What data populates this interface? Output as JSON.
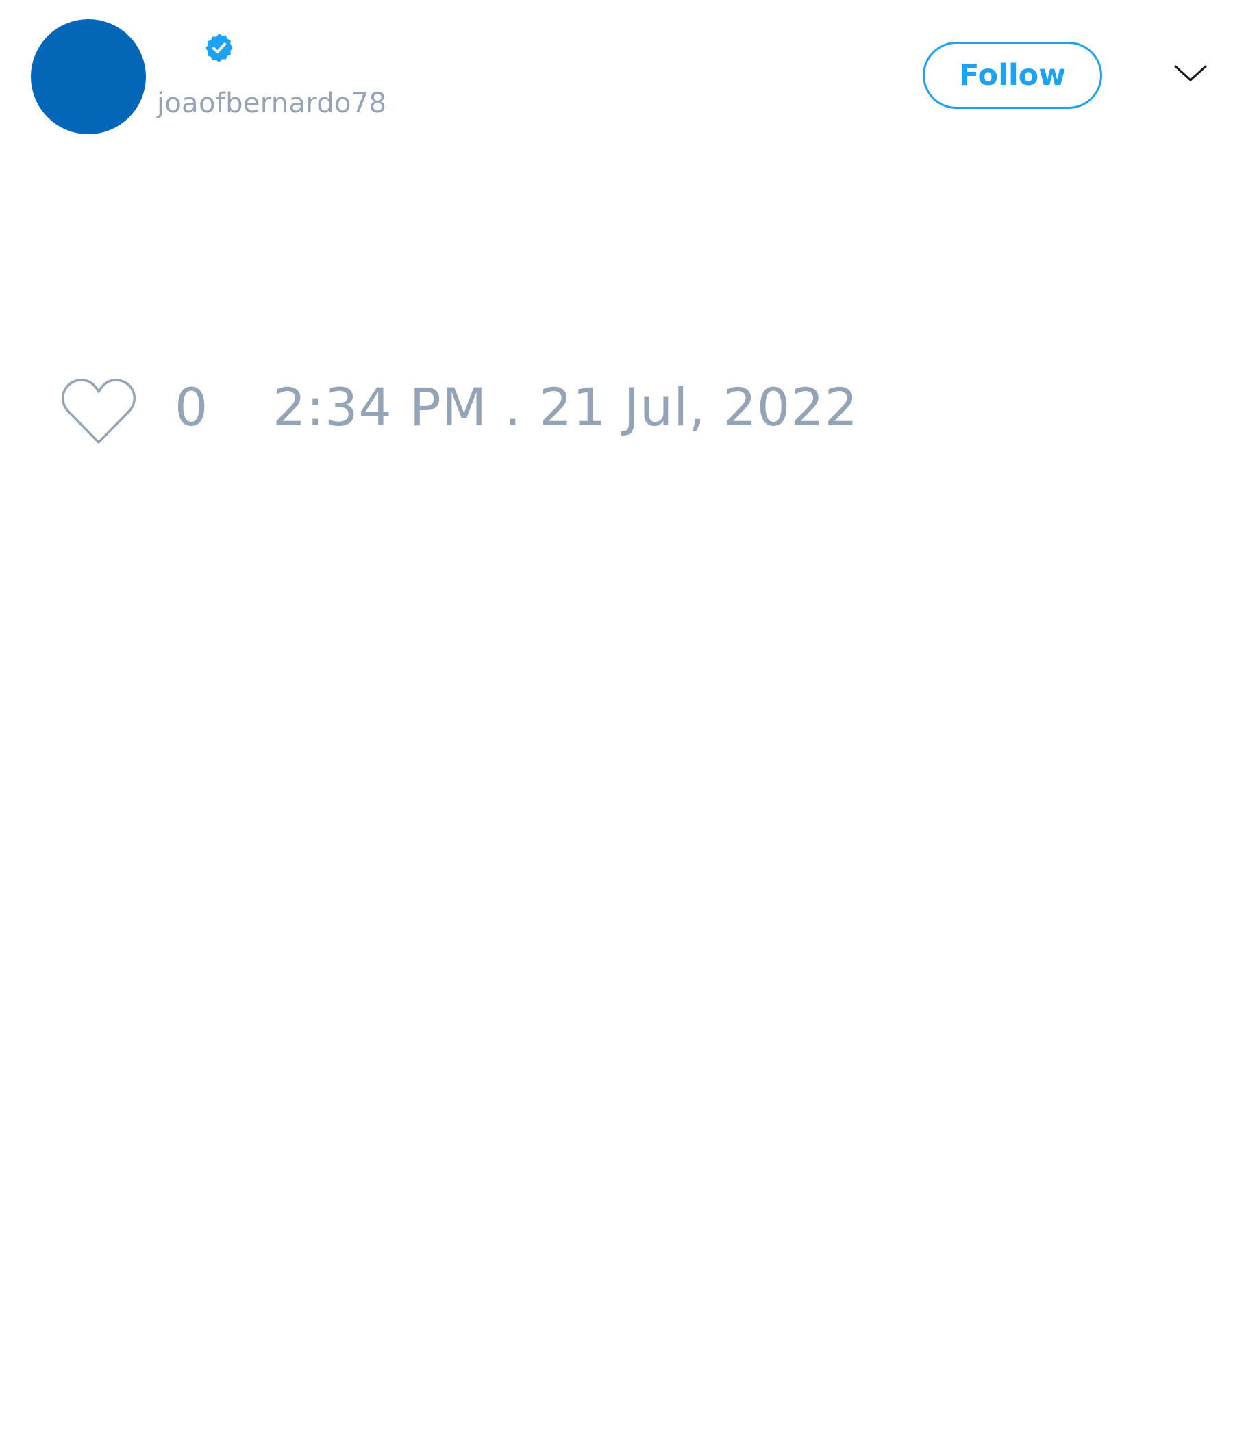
{
  "tweet": {
    "author": {
      "display_name": "",
      "handle": "joaofbernardo78",
      "verified": true,
      "avatar_color": "#0366b6"
    },
    "follow_label": "Follow",
    "like_count": "0",
    "timestamp": "2:34 PM . 21 Jul, 2022"
  },
  "colors": {
    "accent": "#1da1f2",
    "muted_text": "#95a3b6",
    "avatar": "#0366b6"
  },
  "icons": {
    "verified": "verified-badge-icon",
    "menu": "chevron-down-icon",
    "like": "heart-icon"
  }
}
